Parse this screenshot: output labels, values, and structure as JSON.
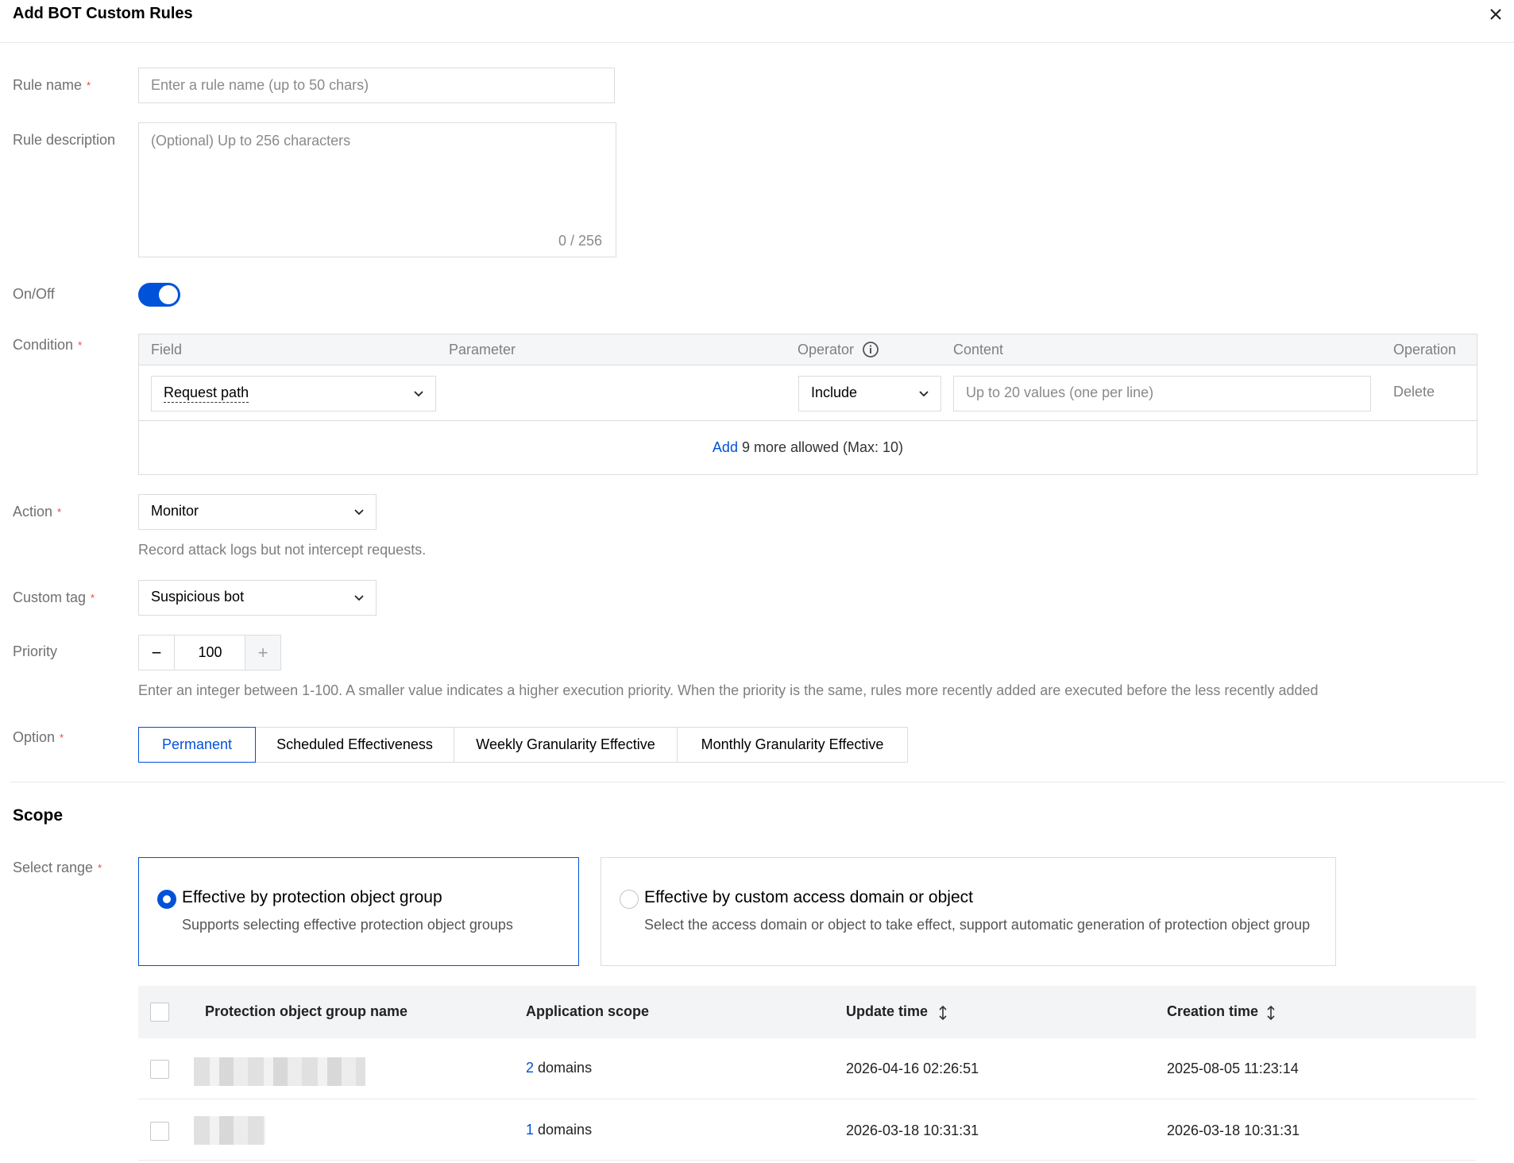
{
  "dialog": {
    "title": "Add BOT Custom Rules"
  },
  "form": {
    "rule_name": {
      "label": "Rule name",
      "required_mark": "*",
      "placeholder": "Enter a rule name (up to 50 chars)"
    },
    "rule_description": {
      "label": "Rule description",
      "placeholder": "(Optional) Up to 256 characters",
      "counter": "0 / 256"
    },
    "on_off": {
      "label": "On/Off",
      "enabled": true
    },
    "condition": {
      "label": "Condition",
      "required_mark": "*",
      "columns": {
        "field": "Field",
        "parameter": "Parameter",
        "operator": "Operator",
        "content": "Content",
        "operation": "Operation"
      },
      "row": {
        "field_value": "Request path",
        "operator_value": "Include",
        "content_placeholder": "Up to 20 values (one per line)",
        "delete_label": "Delete"
      },
      "add_label": "Add",
      "add_note": "9 more allowed (Max: 10)"
    },
    "action": {
      "label": "Action",
      "required_mark": "*",
      "value": "Monitor",
      "hint": "Record attack logs but not intercept requests."
    },
    "custom_tag": {
      "label": "Custom tag",
      "required_mark": "*",
      "value": "Suspicious bot"
    },
    "priority": {
      "label": "Priority",
      "value": "100",
      "minus": "−",
      "plus": "+",
      "hint": "Enter an integer between 1-100. A smaller value indicates a higher execution priority. When the priority is the same, rules more recently added are executed before the less recently added"
    },
    "option": {
      "label": "Option",
      "required_mark": "*",
      "tabs": [
        "Permanent",
        "Scheduled Effectiveness",
        "Weekly Granularity Effective",
        "Monthly Granularity Effective"
      ],
      "selected": "Permanent"
    }
  },
  "scope": {
    "title": "Scope",
    "select_range": {
      "label": "Select range",
      "required_mark": "*",
      "options": [
        {
          "title": "Effective by protection object group",
          "desc": "Supports selecting effective protection object groups",
          "selected": true
        },
        {
          "title": "Effective by custom access domain or object",
          "desc": "Select the access domain or object to take effect, support automatic generation of protection object group",
          "selected": false
        }
      ]
    },
    "table": {
      "headers": [
        "Protection object group name",
        "Application scope",
        "Update time",
        "Creation time"
      ],
      "rows": [
        {
          "count": "2",
          "scope_suffix": "domains",
          "update_time": "2026-04-16 02:26:51",
          "creation_time": "2025-08-05 11:23:14"
        },
        {
          "count": "1",
          "scope_suffix": "domains",
          "update_time": "2026-03-18 10:31:31",
          "creation_time": "2026-03-18 10:31:31"
        }
      ]
    }
  },
  "colors": {
    "primary": "#0052d9",
    "required": "#e54545",
    "border": "#dcdcdc"
  }
}
